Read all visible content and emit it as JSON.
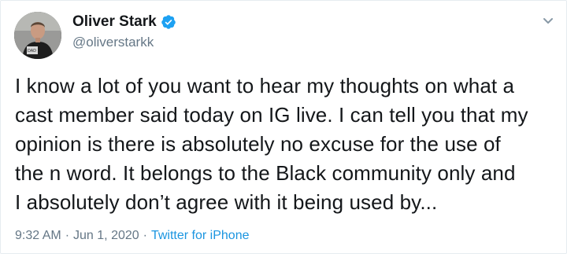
{
  "user": {
    "display_name": "Oliver Stark",
    "handle": "@oliverstarkk",
    "verified": true
  },
  "tweet": {
    "lines": [
      "I know a lot of you want to hear my thoughts on what a",
      "cast member said today on IG live. I can tell you that my",
      "opinion is there is absolutely no excuse for the use of",
      "the n word. It belongs to the Black community only and",
      "I absolutely don’t agree with it being used by..."
    ],
    "time": "9:32 AM",
    "date": "Jun 1, 2020",
    "separator": "·",
    "source": "Twitter for iPhone"
  },
  "icons": {
    "verified": "verified-badge-icon",
    "more": "chevron-down-icon"
  },
  "colors": {
    "accent": "#1da1f2",
    "link": "#1b95e0",
    "secondary_text": "#657786",
    "primary_text": "#14171a"
  }
}
